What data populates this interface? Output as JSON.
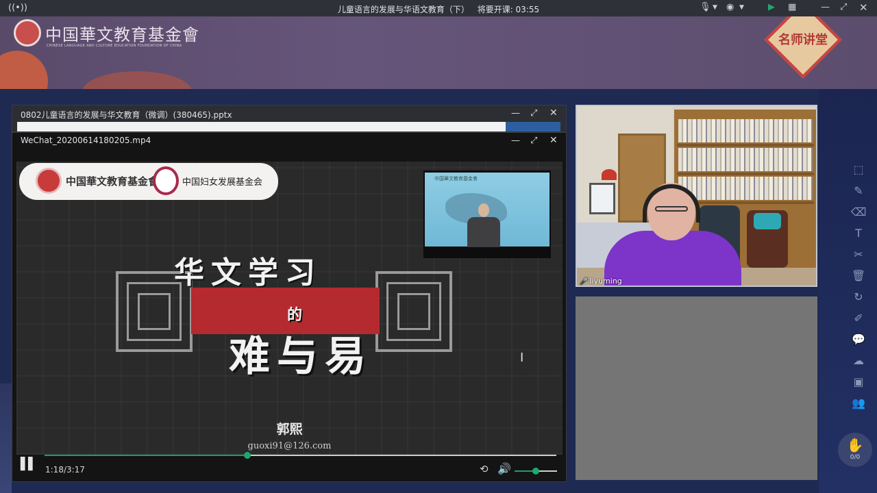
{
  "titlebar": {
    "live_icon": "broadcast-icon",
    "title": "儿童语言的发展与华语文教育（下）",
    "countdown_label": "将要开课: 03:55",
    "icons": [
      "mic-muted-icon",
      "camera-icon",
      "screen-share-icon",
      "grid-icon",
      "minimize-icon",
      "restore-icon",
      "close-icon"
    ]
  },
  "banner": {
    "foundation_cn": "中国華文教育基金會",
    "foundation_en": "CHINESE LANGUAGE AND CULTURE EDUCATION FOUNDATION OF CHINA",
    "badge": "名师讲堂"
  },
  "pptx_window": {
    "title": "0802儿童语言的发展与华文教育（微调）(380465).pptx"
  },
  "video_window": {
    "title": "WeChat_20200614180205.mp4",
    "logo1": "中国華文教育基金會",
    "logo2": "中国妇女发展基金会",
    "pip_label": "中国華文教育基金會",
    "slide_title": "华文学习",
    "slide_of": "的",
    "slide_main": "难与易",
    "author": "郭熙",
    "email": "guoxi91@126.com",
    "time": "1:18/3:17",
    "progress_fraction": 0.396,
    "volume_fraction": 0.5
  },
  "webcam": {
    "name": "liyuming"
  },
  "hand": {
    "count": "0/0"
  },
  "tools": [
    "select-icon",
    "pen-icon",
    "eraser-icon",
    "text-icon",
    "scissors-icon",
    "trash-icon",
    "rotate-icon",
    "edit-icon",
    "chat-icon",
    "cloud-icon",
    "toolbox-icon",
    "users-icon"
  ],
  "colors": {
    "accent_green": "#1fa871",
    "banner_purple": "#66557a",
    "slide_red": "#b52a2f"
  }
}
